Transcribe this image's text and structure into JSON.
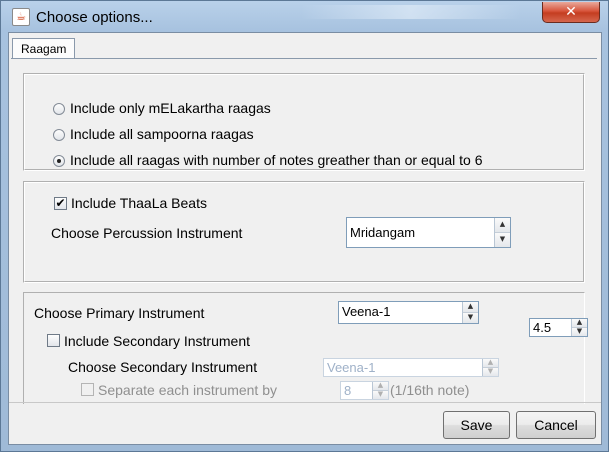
{
  "window": {
    "title": "Choose options...",
    "close_glyph": "✕",
    "app_icon": "java-coffee-icon"
  },
  "tabs": [
    {
      "label": "Raagam",
      "selected": true
    }
  ],
  "raaga_filter": {
    "options": [
      {
        "label": "Include only mELakartha raagas",
        "selected": false
      },
      {
        "label": "Include all sampoorna raagas",
        "selected": false
      },
      {
        "label": "Include all raagas with number of notes greather than or equal to 6",
        "selected": true
      }
    ]
  },
  "thaala": {
    "include_beats_label": "Include ThaaLa Beats",
    "include_beats_checked": true,
    "check_glyph": "✔",
    "percussion_label": "Choose Percussion Instrument",
    "percussion_value": "Mridangam"
  },
  "instruments": {
    "primary_label": "Choose Primary Instrument",
    "primary_value": "Veena-1",
    "ratio_value": "4.5",
    "include_secondary_label": "Include Secondary Instrument",
    "include_secondary_checked": false,
    "secondary_label": "Choose Secondary Instrument",
    "secondary_value": "Veena-1",
    "separate_label": "Separate each instrument by",
    "separate_value": "8",
    "separate_unit": "(1/16th note)"
  },
  "spin_glyphs": {
    "up": "▲",
    "down": "▼"
  },
  "buttons": {
    "save": "Save",
    "cancel": "Cancel"
  }
}
